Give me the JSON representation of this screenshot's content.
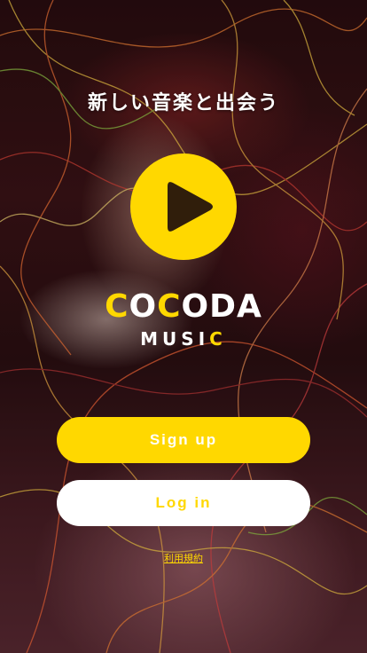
{
  "tagline": "新しい音楽と出会う",
  "logo": {
    "mark_icon": "play-icon",
    "word_parts": [
      {
        "text": "C",
        "accent": true
      },
      {
        "text": "O",
        "accent": false
      },
      {
        "text": "C",
        "accent": true
      },
      {
        "text": "ODA",
        "accent": false
      }
    ],
    "sub_parts": [
      {
        "text": "MUSI",
        "accent": false
      },
      {
        "text": "C",
        "accent": true
      }
    ]
  },
  "buttons": {
    "signup_label": "Sign up",
    "login_label": "Log in"
  },
  "terms_link": "利用規約",
  "colors": {
    "accent": "#ffd800",
    "white": "#ffffff"
  }
}
